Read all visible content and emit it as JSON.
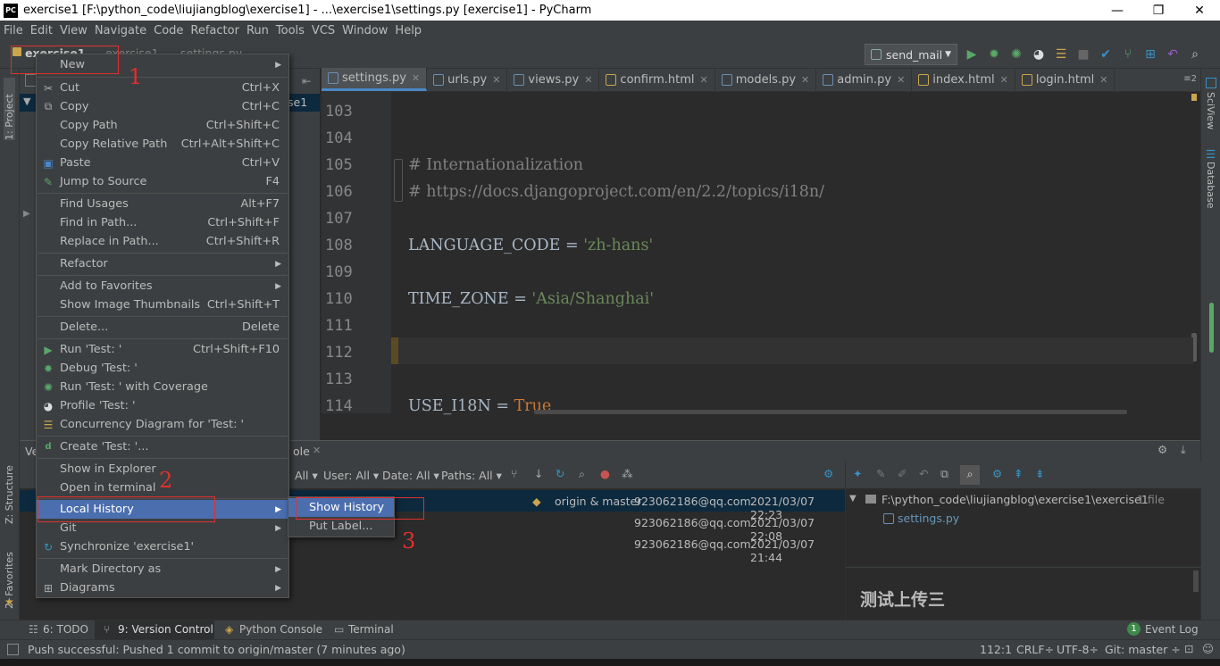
{
  "window": {
    "title": "exercise1 [F:\\python_code\\liujiangblog\\exercise1] - ...\\exercise1\\settings.py [exercise1] - PyCharm",
    "app_icon": "PC"
  },
  "menubar": [
    "File",
    "Edit",
    "View",
    "Navigate",
    "Code",
    "Refactor",
    "Run",
    "Tools",
    "VCS",
    "Window",
    "Help"
  ],
  "navbar": {
    "breadcrumb": [
      "exercise1",
      "exercise1",
      "settings.py"
    ]
  },
  "run_config": {
    "label": "send_mail"
  },
  "left_stripe": {
    "project": "1: Project",
    "structure": "Z: Structure",
    "favorites": "2: Favorites"
  },
  "right_stripe": {
    "sciview": "SciView",
    "database": "Database"
  },
  "project_panel": {
    "selected_suffix": "se1"
  },
  "tabs": [
    {
      "label": "settings.py",
      "active": true
    },
    {
      "label": "urls.py"
    },
    {
      "label": "views.py"
    },
    {
      "label": "confirm.html"
    },
    {
      "label": "models.py"
    },
    {
      "label": "admin.py"
    },
    {
      "label": "index.html"
    },
    {
      "label": "login.html"
    }
  ],
  "tabs_overflow": "2",
  "editor": {
    "line_numbers": [
      "103",
      "104",
      "105",
      "106",
      "107",
      "108",
      "109",
      "110",
      "111",
      "112",
      "113",
      "114"
    ],
    "comment1": "# Internationalization",
    "comment2": "# https://docs.djangoproject.com/en/2.2/topics/i18n/",
    "lang_name": "LANGUAGE_CODE",
    "lang_val": "'zh-hans'",
    "tz_name": "TIME_ZONE",
    "tz_val": "'Asia/Shanghai'",
    "i18n_name": "USE_I18N",
    "i18n_val": "True",
    "eq": " = "
  },
  "context_menu": {
    "items": [
      {
        "label": "New",
        "submenu": true
      },
      {
        "label": "Cut",
        "shortcut": "Ctrl+X",
        "icon": "scissors-icon"
      },
      {
        "label": "Copy",
        "shortcut": "Ctrl+C",
        "icon": "copy-icon"
      },
      {
        "label": "Copy Path",
        "shortcut": "Ctrl+Shift+C"
      },
      {
        "label": "Copy Relative Path",
        "shortcut": "Ctrl+Alt+Shift+C"
      },
      {
        "label": "Paste",
        "shortcut": "Ctrl+V",
        "icon": "paste-icon"
      },
      {
        "label": "Jump to Source",
        "shortcut": "F4",
        "icon": "jump-icon"
      },
      {
        "label": "Find Usages",
        "shortcut": "Alt+F7"
      },
      {
        "label": "Find in Path...",
        "shortcut": "Ctrl+Shift+F"
      },
      {
        "label": "Replace in Path...",
        "shortcut": "Ctrl+Shift+R"
      },
      {
        "label": "Refactor",
        "submenu": true
      },
      {
        "label": "Add to Favorites",
        "submenu": true
      },
      {
        "label": "Show Image Thumbnails",
        "shortcut": "Ctrl+Shift+T"
      },
      {
        "label": "Delete...",
        "shortcut": "Delete"
      },
      {
        "label": "Run 'Test: '",
        "shortcut": "Ctrl+Shift+F10",
        "icon": "run-icon"
      },
      {
        "label": "Debug 'Test: '",
        "icon": "debug-icon"
      },
      {
        "label": "Run 'Test: ' with Coverage",
        "icon": "coverage-icon"
      },
      {
        "label": "Profile 'Test: '",
        "icon": "profile-icon"
      },
      {
        "label": "Concurrency Diagram for 'Test: '",
        "icon": "concurrency-icon"
      },
      {
        "label": "Create 'Test: '...",
        "icon": "create-test-icon"
      },
      {
        "label": "Show in Explorer"
      },
      {
        "label": "Open in terminal"
      },
      {
        "label": "Local History",
        "submenu": true,
        "selected": true
      },
      {
        "label": "Git",
        "submenu": true
      },
      {
        "label": "Synchronize 'exercise1'",
        "icon": "sync-icon"
      },
      {
        "label": "Mark Directory as",
        "submenu": true
      },
      {
        "label": "Diagrams",
        "submenu": true,
        "icon": "diagrams-icon"
      }
    ]
  },
  "submenu": {
    "items": [
      "Show History",
      "Put Label..."
    ]
  },
  "annotations": {
    "n1": "1",
    "n2": "2",
    "n3": "3"
  },
  "vc_panel": {
    "tab_prefix": "Ve",
    "console_tab": "ole",
    "filters": [
      "All ▾",
      "User: All ▾",
      "Date: All ▾",
      "Paths: All ▾"
    ],
    "log": [
      {
        "refs": "origin & master",
        "author": "923062186@qq.com",
        "date": "2021/03/07 22:23"
      },
      {
        "author": "923062186@qq.com",
        "date": "2021/03/07 22:08"
      },
      {
        "author": "923062186@qq.com",
        "date": "2021/03/07 21:44"
      }
    ],
    "changes_path": "F:\\python_code\\liujiangblog\\exercise1\\exercise1",
    "changes_count": "1 file",
    "changed_file": "settings.py",
    "commit_message": "测试上传三"
  },
  "tool_windows": [
    {
      "label": "6: TODO"
    },
    {
      "label": "9: Version Control",
      "active": true
    },
    {
      "label": "Python Console"
    },
    {
      "label": "Terminal"
    }
  ],
  "event_log": {
    "count": "1",
    "label": "Event Log"
  },
  "status": {
    "message": "Push successful: Pushed 1 commit to origin/master (7 minutes ago)",
    "position": "112:1",
    "line_sep": "CRLF÷",
    "encoding": "UTF-8÷",
    "vcs": "Git: master ÷"
  }
}
